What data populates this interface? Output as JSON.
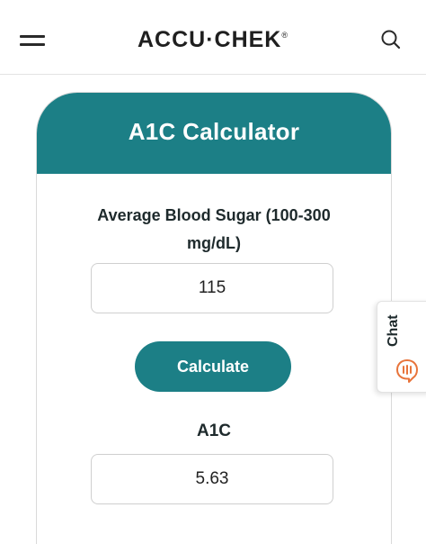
{
  "header": {
    "logo_text": "ACCU·CHEK",
    "logo_mark": "®",
    "menu_icon": "hamburger-menu-icon",
    "search_icon": "search-icon"
  },
  "calculator": {
    "title": "A1C Calculator",
    "avg_label": "Average Blood Sugar (100-300 mg/dL)",
    "avg_value": "115",
    "button_label": "Calculate",
    "result_label": "A1C",
    "result_value": "5.63"
  },
  "chat": {
    "label": "Chat",
    "icon": "chat-bubble-icon"
  },
  "colors": {
    "accent": "#1c7f86",
    "chat_icon": "#e8743b",
    "text": "#1e2a2c"
  }
}
